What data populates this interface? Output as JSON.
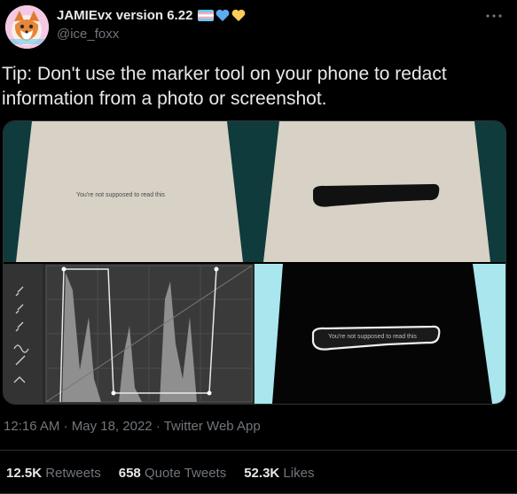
{
  "author": {
    "display_name": "JAMIEvx version 6.22",
    "handle": "@ice_foxx",
    "badges": [
      "transgender-flag-emoji",
      "blue-heart-emoji",
      "yellow-heart-emoji"
    ]
  },
  "tweet": {
    "text": "Tip: Don't use the marker tool on your phone to redact information from a photo or screenshot.",
    "media": {
      "paper_caption": "You're not supposed to read this",
      "revealed_caption": "You're not supposed to read this"
    }
  },
  "meta": {
    "time": "12:16 AM",
    "date": "May 18, 2022",
    "source": "Twitter Web App",
    "separator": "·"
  },
  "stats": {
    "retweets_count": "12.5K",
    "retweets_label": "Retweets",
    "quotes_count": "658",
    "quotes_label": "Quote Tweets",
    "likes_count": "52.3K",
    "likes_label": "Likes"
  },
  "colors": {
    "background": "#000000",
    "text": "#e7e9ea",
    "secondary": "#71767b",
    "divider": "#2f3336",
    "paper": "#d8d1c5",
    "teal_bg": "#0e3b3a"
  }
}
